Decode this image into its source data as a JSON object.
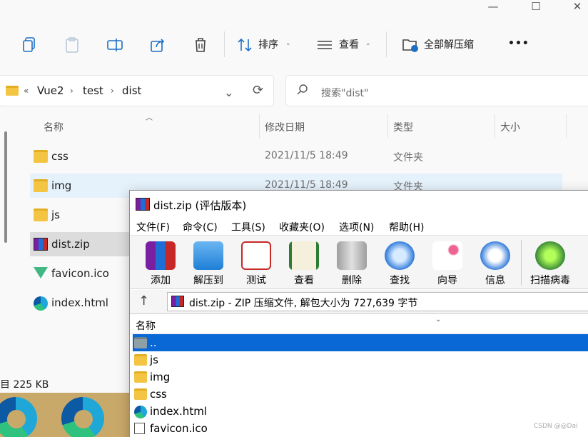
{
  "explorer": {
    "window_controls": {
      "minimize": "—",
      "maximize": "☐",
      "close": "✕"
    },
    "commands": {
      "sort_label": "排序",
      "view_label": "查看",
      "extract_all_label": "全部解压缩",
      "more_label": "•••"
    },
    "address": {
      "chevron": "«",
      "crumbs": [
        "Vue2",
        "test",
        "dist"
      ],
      "separator": "›"
    },
    "search": {
      "placeholder": "搜索\"dist\""
    },
    "columns": {
      "name": "名称",
      "modified": "修改日期",
      "type": "类型",
      "size": "大小"
    },
    "files": [
      {
        "name": "css",
        "date": "2021/11/5 18:49",
        "type": "文件夹",
        "icon": "folder-icon"
      },
      {
        "name": "img",
        "date": "2021/11/5 18:49",
        "type": "文件夹",
        "icon": "folder-icon"
      },
      {
        "name": "js",
        "date": "",
        "type": "",
        "icon": "folder-icon"
      },
      {
        "name": "dist.zip",
        "date": "",
        "type": "",
        "icon": "winrar-icon"
      },
      {
        "name": "favicon.ico",
        "date": "",
        "type": "",
        "icon": "vue-icon"
      },
      {
        "name": "index.html",
        "date": "",
        "type": "",
        "icon": "edge-icon"
      }
    ],
    "status": "目  225 KB"
  },
  "winrar": {
    "title": "dist.zip (评估版本)",
    "menu": [
      "文件(F)",
      "命令(C)",
      "工具(S)",
      "收藏夹(O)",
      "选项(N)",
      "帮助(H)"
    ],
    "tools": [
      "添加",
      "解压到",
      "测试",
      "查看",
      "删除",
      "查找",
      "向导",
      "信息",
      "扫描病毒"
    ],
    "address_text": "dist.zip - ZIP 压缩文件, 解包大小为 727,639 字节",
    "list_header": "名称",
    "entries": [
      {
        "name": "..",
        "icon": "parent-folder-icon"
      },
      {
        "name": "js",
        "icon": "folder-icon"
      },
      {
        "name": "img",
        "icon": "folder-icon"
      },
      {
        "name": "css",
        "icon": "folder-icon"
      },
      {
        "name": "index.html",
        "icon": "edge-icon"
      },
      {
        "name": "favicon.ico",
        "icon": "file-icon"
      }
    ]
  },
  "watermark": "CSDN @@Dai"
}
